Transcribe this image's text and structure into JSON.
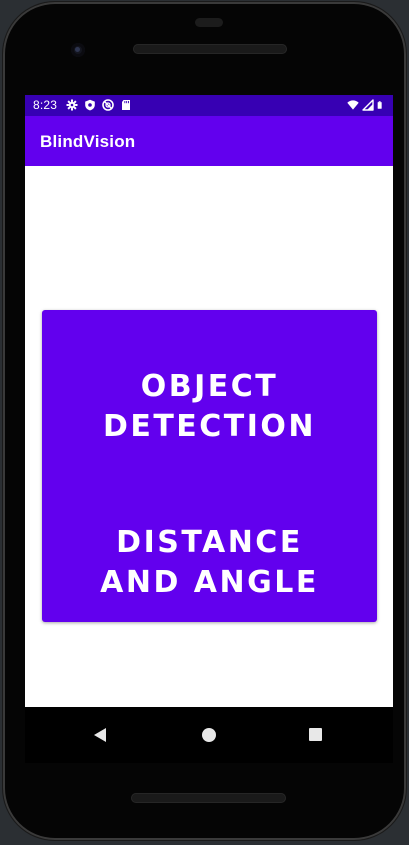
{
  "status_bar": {
    "time": "8:23",
    "left_icons": [
      "settings-gear-icon",
      "shield-icon",
      "do-not-disturb-icon",
      "sd-card-icon"
    ],
    "right_icons": [
      "wifi-icon",
      "cell-signal-icon",
      "battery-icon"
    ]
  },
  "app_bar": {
    "title": "BlindVision"
  },
  "main": {
    "object_detection_label": "OBJECT\nDETECTION",
    "distance_angle_label": "DISTANCE\nAND ANGLE"
  },
  "nav_bar": {
    "icons": [
      "back-icon",
      "home-icon",
      "recents-icon"
    ]
  },
  "colors": {
    "status_bar": "#3700b3",
    "primary": "#6200ee",
    "on_primary": "#ffffff",
    "nav_bar": "#000000"
  }
}
